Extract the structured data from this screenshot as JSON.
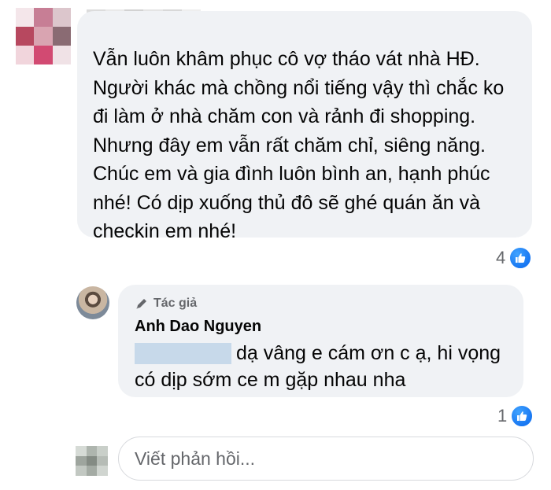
{
  "comment": {
    "text": "Vẫn luôn khâm phục cô vợ tháo vát nhà HĐ.\nNgười khác mà chồng nổi tiếng vậy thì chắc ko\nđi làm ở nhà chăm con và rảnh đi shopping.\nNhưng đây em vẫn rất chăm chỉ, siêng năng.\nChúc em và gia đình luôn bình an, hạnh phúc\nnhé! Có dịp xuống thủ đô sẽ ghé quán ăn và\ncheckin em nhé!",
    "reaction_count": "4",
    "reaction_icon": "like-icon"
  },
  "reply": {
    "author_badge": "Tác giả",
    "author_name": "Anh Dao Nguyen",
    "text_line1": "dạ vâng e cám ơn c ạ, hi vọng",
    "text_line2": "có dịp sớm ce m gặp nhau nha",
    "reaction_count": "1",
    "reaction_icon": "like-icon"
  },
  "composer": {
    "placeholder": "Viết phản hồi..."
  },
  "colors": {
    "bubble": "#f0f2f5",
    "like_blue": "#1877f2",
    "secondary_text": "#65676b"
  }
}
